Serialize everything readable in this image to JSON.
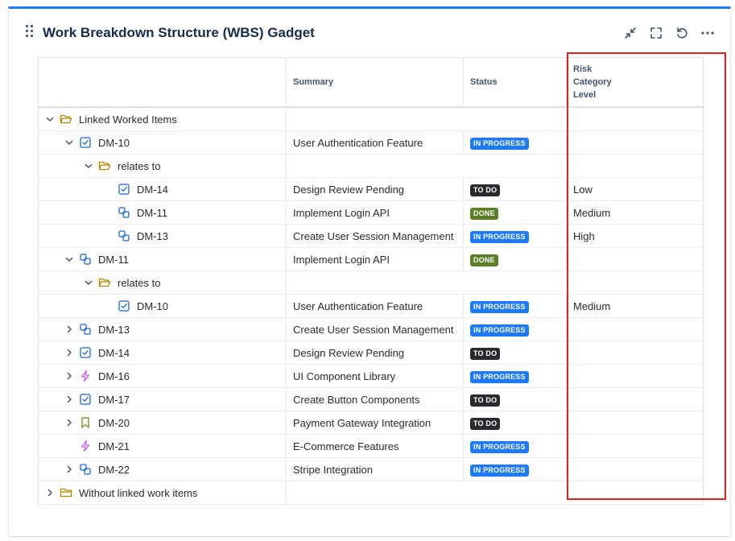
{
  "gadget": {
    "title": "Work Breakdown Structure (WBS) Gadget",
    "accent_color": "#1d7afc",
    "header_icons": [
      "minimize-icon",
      "fullscreen-icon",
      "refresh-icon",
      "more-icon"
    ]
  },
  "table": {
    "columns": [
      "",
      "Summary",
      "Status",
      "Risk Category Level"
    ],
    "risk_header_lines": [
      "Risk",
      "Category",
      "Level"
    ],
    "rows": [
      {
        "indent": 0,
        "chevron": "down",
        "icon": "folder-open",
        "key": "Linked Worked Items",
        "summary": "",
        "status": "",
        "status_type": "",
        "risk": "",
        "group": true
      },
      {
        "indent": 1,
        "chevron": "down",
        "icon": "task",
        "key": "DM-10",
        "summary": "User Authentication Feature",
        "status": "IN PROGRESS",
        "status_type": "prog",
        "risk": ""
      },
      {
        "indent": 2,
        "chevron": "down",
        "icon": "folder-open",
        "key": "relates to",
        "summary": "",
        "status": "",
        "status_type": "",
        "risk": "",
        "group": true
      },
      {
        "indent": 3,
        "chevron": "none",
        "icon": "task",
        "key": "DM-14",
        "summary": "Design Review Pending",
        "status": "TO DO",
        "status_type": "todo",
        "risk": "Low"
      },
      {
        "indent": 3,
        "chevron": "none",
        "icon": "subtask",
        "key": "DM-11",
        "summary": "Implement Login API",
        "status": "DONE",
        "status_type": "done",
        "risk": "Medium"
      },
      {
        "indent": 3,
        "chevron": "none",
        "icon": "subtask",
        "key": "DM-13",
        "summary": "Create User Session Management",
        "status": "IN PROGRESS",
        "status_type": "prog",
        "risk": "High"
      },
      {
        "indent": 1,
        "chevron": "down",
        "icon": "subtask",
        "key": "DM-11",
        "summary": "Implement Login API",
        "status": "DONE",
        "status_type": "done",
        "risk": ""
      },
      {
        "indent": 2,
        "chevron": "down",
        "icon": "folder-open",
        "key": "relates to",
        "summary": "",
        "status": "",
        "status_type": "",
        "risk": "",
        "group": true
      },
      {
        "indent": 3,
        "chevron": "none",
        "icon": "task",
        "key": "DM-10",
        "summary": "User Authentication Feature",
        "status": "IN PROGRESS",
        "status_type": "prog",
        "risk": "Medium"
      },
      {
        "indent": 1,
        "chevron": "right",
        "icon": "subtask",
        "key": "DM-13",
        "summary": "Create User Session Management",
        "status": "IN PROGRESS",
        "status_type": "prog",
        "risk": ""
      },
      {
        "indent": 1,
        "chevron": "right",
        "icon": "task",
        "key": "DM-14",
        "summary": "Design Review Pending",
        "status": "TO DO",
        "status_type": "todo",
        "risk": ""
      },
      {
        "indent": 1,
        "chevron": "right",
        "icon": "epic",
        "key": "DM-16",
        "summary": "UI Component Library",
        "status": "IN PROGRESS",
        "status_type": "prog",
        "risk": ""
      },
      {
        "indent": 1,
        "chevron": "right",
        "icon": "task",
        "key": "DM-17",
        "summary": "Create Button Components",
        "status": "TO DO",
        "status_type": "todo",
        "risk": ""
      },
      {
        "indent": 1,
        "chevron": "right",
        "icon": "story",
        "key": "DM-20",
        "summary": "Payment Gateway Integration",
        "status": "TO DO",
        "status_type": "todo",
        "risk": ""
      },
      {
        "indent": 1,
        "chevron": "none",
        "icon": "epic",
        "key": "DM-21",
        "summary": "E-Commerce Features",
        "status": "IN PROGRESS",
        "status_type": "prog",
        "risk": ""
      },
      {
        "indent": 1,
        "chevron": "right",
        "icon": "subtask",
        "key": "DM-22",
        "summary": "Stripe Integration",
        "status": "IN PROGRESS",
        "status_type": "prog",
        "risk": ""
      },
      {
        "indent": 0,
        "chevron": "right",
        "icon": "folder-closed",
        "key": "Without linked work items",
        "summary": "",
        "status": "",
        "status_type": "",
        "risk": "",
        "group": true
      }
    ]
  },
  "colors": {
    "in_progress": "#1d7afc",
    "to_do": "#292a2e",
    "done": "#5b7f24",
    "task_icon": "#1868db",
    "subtask_icon": "#1868db",
    "epic_icon": "#bf63f3",
    "story_icon": "#6a9a23",
    "folder_icon": "#b38600",
    "highlight_box": "#e2231a"
  }
}
